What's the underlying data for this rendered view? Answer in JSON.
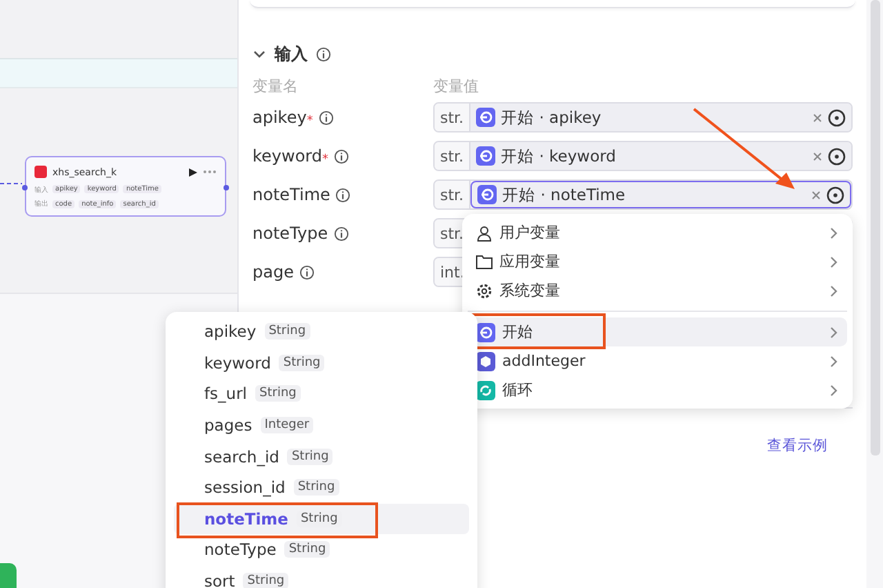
{
  "canvas": {
    "node": {
      "title": "xhs_search_k",
      "inputs_label": "输入",
      "inputs": [
        "apikey",
        "keyword",
        "noteTime"
      ],
      "outputs_label": "输出",
      "outputs": [
        "code",
        "note_info",
        "search_id"
      ]
    }
  },
  "panel": {
    "section": {
      "title": "输入",
      "expanded": true
    },
    "columns": [
      "变量名",
      "变量值"
    ],
    "rows": [
      {
        "name": "apikey",
        "mark": "*",
        "type": "str.",
        "value": "开始 · apikey",
        "focused": false
      },
      {
        "name": "keyword",
        "mark": "*",
        "type": "str.",
        "value": "开始 · keyword",
        "focused": false
      },
      {
        "name": "noteTime",
        "type": "str.",
        "value": "开始 · noteTime",
        "focused": true
      },
      {
        "name": "noteType",
        "type": "str."
      },
      {
        "name": "page",
        "type": "int."
      }
    ],
    "example_link": "查看示例"
  },
  "source_menu": {
    "items": [
      {
        "kind": "user",
        "label": "用户变量",
        "selected": false
      },
      {
        "kind": "folder",
        "label": "应用变量",
        "selected": false
      },
      {
        "kind": "gear",
        "label": "系统变量",
        "selected": false
      },
      {
        "kind": "start",
        "label": "开始",
        "selected": true
      },
      {
        "kind": "block",
        "label": "addInteger",
        "selected": false
      },
      {
        "kind": "loop",
        "label": "循环",
        "selected": false
      }
    ]
  },
  "variable_menu": {
    "items": [
      {
        "name": "apikey",
        "type": "String",
        "selected": false
      },
      {
        "name": "keyword",
        "type": "String",
        "selected": false
      },
      {
        "name": "fs_url",
        "type": "String",
        "selected": false
      },
      {
        "name": "pages",
        "type": "Integer",
        "selected": false
      },
      {
        "name": "search_id",
        "type": "String",
        "selected": false
      },
      {
        "name": "session_id",
        "type": "String",
        "selected": false
      },
      {
        "name": "noteTime",
        "type": "String",
        "selected": true
      },
      {
        "name": "noteType",
        "type": "String",
        "selected": false
      },
      {
        "name": "sort",
        "type": "String",
        "selected": false
      }
    ]
  }
}
